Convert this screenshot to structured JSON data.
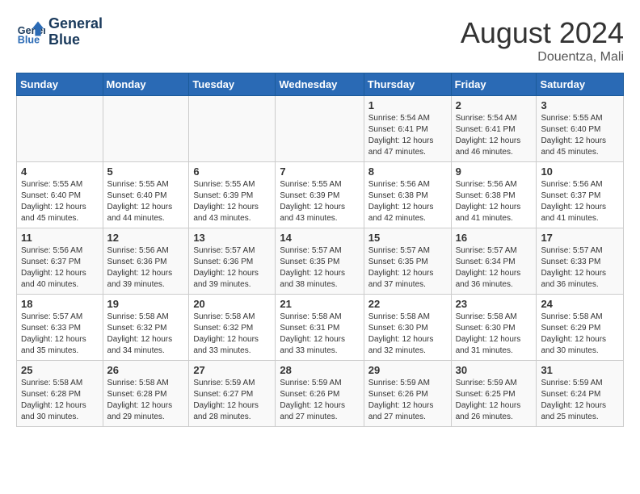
{
  "header": {
    "title": "August 2024",
    "location": "Douentza, Mali",
    "logo_line1": "General",
    "logo_line2": "Blue"
  },
  "days_of_week": [
    "Sunday",
    "Monday",
    "Tuesday",
    "Wednesday",
    "Thursday",
    "Friday",
    "Saturday"
  ],
  "weeks": [
    [
      {
        "day": "",
        "info": ""
      },
      {
        "day": "",
        "info": ""
      },
      {
        "day": "",
        "info": ""
      },
      {
        "day": "",
        "info": ""
      },
      {
        "day": "1",
        "info": "Sunrise: 5:54 AM\nSunset: 6:41 PM\nDaylight: 12 hours\nand 47 minutes."
      },
      {
        "day": "2",
        "info": "Sunrise: 5:54 AM\nSunset: 6:41 PM\nDaylight: 12 hours\nand 46 minutes."
      },
      {
        "day": "3",
        "info": "Sunrise: 5:55 AM\nSunset: 6:40 PM\nDaylight: 12 hours\nand 45 minutes."
      }
    ],
    [
      {
        "day": "4",
        "info": "Sunrise: 5:55 AM\nSunset: 6:40 PM\nDaylight: 12 hours\nand 45 minutes."
      },
      {
        "day": "5",
        "info": "Sunrise: 5:55 AM\nSunset: 6:40 PM\nDaylight: 12 hours\nand 44 minutes."
      },
      {
        "day": "6",
        "info": "Sunrise: 5:55 AM\nSunset: 6:39 PM\nDaylight: 12 hours\nand 43 minutes."
      },
      {
        "day": "7",
        "info": "Sunrise: 5:55 AM\nSunset: 6:39 PM\nDaylight: 12 hours\nand 43 minutes."
      },
      {
        "day": "8",
        "info": "Sunrise: 5:56 AM\nSunset: 6:38 PM\nDaylight: 12 hours\nand 42 minutes."
      },
      {
        "day": "9",
        "info": "Sunrise: 5:56 AM\nSunset: 6:38 PM\nDaylight: 12 hours\nand 41 minutes."
      },
      {
        "day": "10",
        "info": "Sunrise: 5:56 AM\nSunset: 6:37 PM\nDaylight: 12 hours\nand 41 minutes."
      }
    ],
    [
      {
        "day": "11",
        "info": "Sunrise: 5:56 AM\nSunset: 6:37 PM\nDaylight: 12 hours\nand 40 minutes."
      },
      {
        "day": "12",
        "info": "Sunrise: 5:56 AM\nSunset: 6:36 PM\nDaylight: 12 hours\nand 39 minutes."
      },
      {
        "day": "13",
        "info": "Sunrise: 5:57 AM\nSunset: 6:36 PM\nDaylight: 12 hours\nand 39 minutes."
      },
      {
        "day": "14",
        "info": "Sunrise: 5:57 AM\nSunset: 6:35 PM\nDaylight: 12 hours\nand 38 minutes."
      },
      {
        "day": "15",
        "info": "Sunrise: 5:57 AM\nSunset: 6:35 PM\nDaylight: 12 hours\nand 37 minutes."
      },
      {
        "day": "16",
        "info": "Sunrise: 5:57 AM\nSunset: 6:34 PM\nDaylight: 12 hours\nand 36 minutes."
      },
      {
        "day": "17",
        "info": "Sunrise: 5:57 AM\nSunset: 6:33 PM\nDaylight: 12 hours\nand 36 minutes."
      }
    ],
    [
      {
        "day": "18",
        "info": "Sunrise: 5:57 AM\nSunset: 6:33 PM\nDaylight: 12 hours\nand 35 minutes."
      },
      {
        "day": "19",
        "info": "Sunrise: 5:58 AM\nSunset: 6:32 PM\nDaylight: 12 hours\nand 34 minutes."
      },
      {
        "day": "20",
        "info": "Sunrise: 5:58 AM\nSunset: 6:32 PM\nDaylight: 12 hours\nand 33 minutes."
      },
      {
        "day": "21",
        "info": "Sunrise: 5:58 AM\nSunset: 6:31 PM\nDaylight: 12 hours\nand 33 minutes."
      },
      {
        "day": "22",
        "info": "Sunrise: 5:58 AM\nSunset: 6:30 PM\nDaylight: 12 hours\nand 32 minutes."
      },
      {
        "day": "23",
        "info": "Sunrise: 5:58 AM\nSunset: 6:30 PM\nDaylight: 12 hours\nand 31 minutes."
      },
      {
        "day": "24",
        "info": "Sunrise: 5:58 AM\nSunset: 6:29 PM\nDaylight: 12 hours\nand 30 minutes."
      }
    ],
    [
      {
        "day": "25",
        "info": "Sunrise: 5:58 AM\nSunset: 6:28 PM\nDaylight: 12 hours\nand 30 minutes."
      },
      {
        "day": "26",
        "info": "Sunrise: 5:58 AM\nSunset: 6:28 PM\nDaylight: 12 hours\nand 29 minutes."
      },
      {
        "day": "27",
        "info": "Sunrise: 5:59 AM\nSunset: 6:27 PM\nDaylight: 12 hours\nand 28 minutes."
      },
      {
        "day": "28",
        "info": "Sunrise: 5:59 AM\nSunset: 6:26 PM\nDaylight: 12 hours\nand 27 minutes."
      },
      {
        "day": "29",
        "info": "Sunrise: 5:59 AM\nSunset: 6:26 PM\nDaylight: 12 hours\nand 27 minutes."
      },
      {
        "day": "30",
        "info": "Sunrise: 5:59 AM\nSunset: 6:25 PM\nDaylight: 12 hours\nand 26 minutes."
      },
      {
        "day": "31",
        "info": "Sunrise: 5:59 AM\nSunset: 6:24 PM\nDaylight: 12 hours\nand 25 minutes."
      }
    ]
  ]
}
